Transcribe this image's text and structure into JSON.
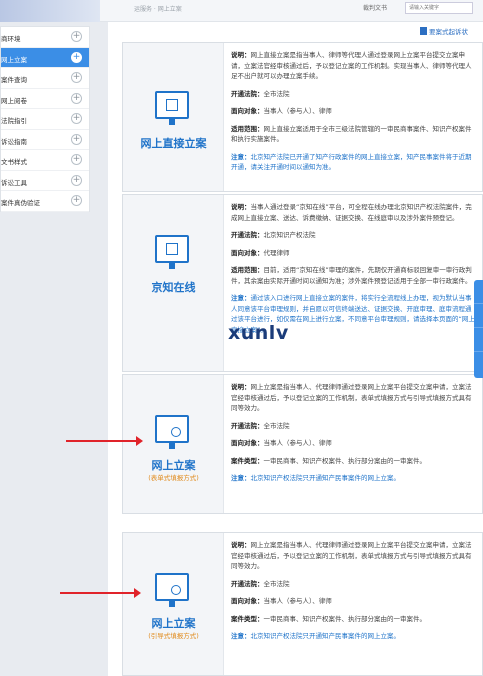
{
  "header": {
    "breadcrumb": "运服务 · 网上立案",
    "search_label": "裁判文书",
    "search_placeholder": "请输入关键字"
  },
  "guide": {
    "label": "要案式起诉状"
  },
  "sidebar": {
    "items": [
      {
        "label": "商环境",
        "active": false
      },
      {
        "label": "网上立案",
        "active": true
      },
      {
        "label": "案件查询",
        "active": false
      },
      {
        "label": "网上阅卷",
        "active": false
      },
      {
        "label": "法院指引",
        "active": false
      },
      {
        "label": "诉讼指南",
        "active": false
      },
      {
        "label": "文书样式",
        "active": false
      },
      {
        "label": "诉讼工具",
        "active": false
      },
      {
        "label": "案件真伪验证",
        "active": false
      }
    ]
  },
  "cards": [
    {
      "title": "网上直接立案",
      "subtitle": "",
      "desc_label": "说明：",
      "desc": "网上直接立案是指当事人、律师等代理人通过登录网上立案平台提交立案申请，立案法官经审核通过后，予以登记立案的工作机制。实现当事人、律师等代理人足不出户就可以办理立案手续。",
      "court_label": "开通法院：",
      "court": "全市法院",
      "target_label": "面向对象：",
      "target": "当事人（参与人）、律师",
      "scope_label": "适用范围：",
      "scope": "网上直接立案适用于全市三级法院管辖的一审民商事案件、知识产权案件和执行实施案件。",
      "note_label": "注意：",
      "note": "北京知产法院已开通了知产行政案件的网上直接立案，知产民事案件将于近期开通，请关注开通时间以通知为准。"
    },
    {
      "title": "京知在线",
      "subtitle": "",
      "desc_label": "说明：",
      "desc": "当事人通过登录“京知在线”平台，可全程在线办理北京知识产权法院案件，完成网上直接立案、送达、诉费缴纳、证据交换、在线庭审以及涉外案件预登记。",
      "court_label": "开通法院：",
      "court": "北京知识产权法院",
      "target_label": "面向对象：",
      "target": "代理律师",
      "scope_label": "适用范围：",
      "scope": "目前，适用“京知在线”审理的案件，先期仅开通商标驳回复审一审行政判件，其余案由实际开通时间以通知为准；涉外案件预登记适用于全部一审行政案件。",
      "note_label": "注意：",
      "note": "通过该入口进行网上直接立案的案件，将实行全流程线上办理，视为默认当事人同意该平台审理规则，并自愿以可信终端送达、证据交换、开庭审理、庭审流程通过该平台进行，如仅需在网上进行立案，不同意平台审理规则，请选择本页面的“网上直接立案”。"
    },
    {
      "title": "网上立案",
      "subtitle": "(表单式填报方式)",
      "desc_label": "说明：",
      "desc": "网上立案是指当事人、代理律师通过登录网上立案平台提交立案申请，立案法官经审核通过后，予以登记立案的工作机制，表单式填报方式与引导式填报方式具有同等效力。",
      "court_label": "开通法院：",
      "court": "全市法院",
      "target_label": "面向对象：",
      "target": "当事人（参与人）、律师",
      "scope_label": "案件类型：",
      "scope": "一审民商事、知识产权案件、执行部分案由的一审案件。",
      "note_label": "注意：",
      "note": "北京知识产权法院只开通知产民事案件的网上立案。"
    },
    {
      "title": "网上立案",
      "subtitle": "(引导式填报方式)",
      "desc_label": "说明：",
      "desc": "网上立案是指当事人、代理律师通过登录网上立案平台提交立案申请，立案法官经审核通过后，予以登记立案的工作机制，表单式填报方式与引导式填报方式具有同等效力。",
      "court_label": "开通法院：",
      "court": "全市法院",
      "target_label": "面向对象：",
      "target": "当事人（参与人）、律师",
      "scope_label": "案件类型：",
      "scope": "一审民商事、知识产权案件、执行部分案由的一审案件。",
      "note_label": "注意：",
      "note": "北京知识产权法院只开通知产民事案件的网上立案。"
    }
  ],
  "watermark": "xunlv",
  "colors": {
    "accent": "#1f73c9",
    "active_nav": "#3b8ee6",
    "subtitle": "#e08a1b",
    "arrow": "#e0232a"
  }
}
